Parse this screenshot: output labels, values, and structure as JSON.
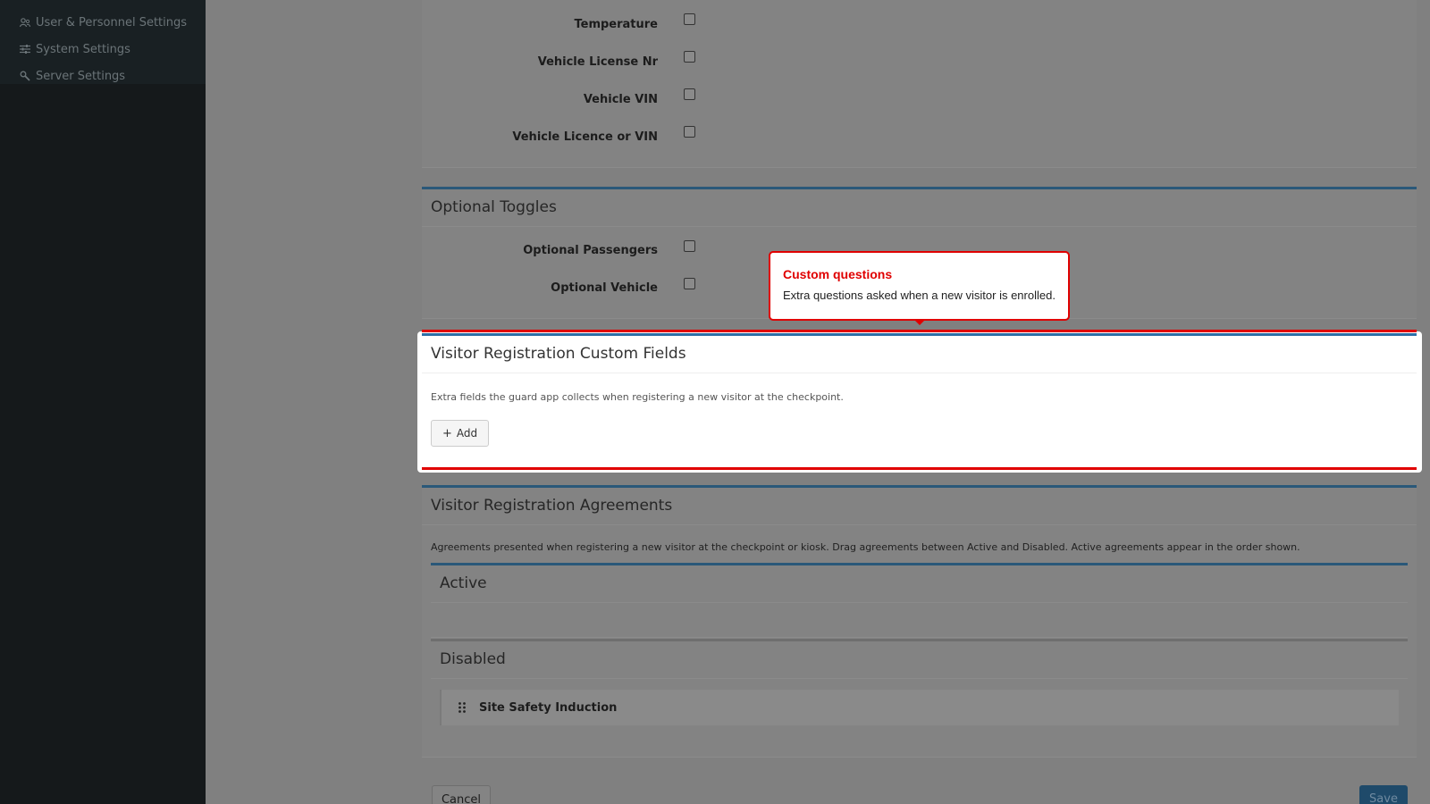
{
  "sidebar": {
    "items": [
      {
        "label": "User & Personnel Settings",
        "icon": "users-icon"
      },
      {
        "label": "System Settings",
        "icon": "sliders-icon"
      },
      {
        "label": "Server Settings",
        "icon": "wrench-icon"
      }
    ]
  },
  "required_fields": {
    "rows": [
      {
        "label": "Temperature",
        "checked": false
      },
      {
        "label": "Vehicle License Nr",
        "checked": false
      },
      {
        "label": "Vehicle VIN",
        "checked": false
      },
      {
        "label": "Vehicle Licence or VIN",
        "checked": false
      }
    ]
  },
  "optional_toggles": {
    "title": "Optional Toggles",
    "rows": [
      {
        "label": "Optional Passengers",
        "checked": false
      },
      {
        "label": "Optional Vehicle",
        "checked": false
      }
    ]
  },
  "custom_fields": {
    "title": "Visitor Registration Custom Fields",
    "description": "Extra fields the guard app collects when registering a new visitor at the checkpoint.",
    "add_label": "Add"
  },
  "tooltip": {
    "title": "Custom questions",
    "body": "Extra questions asked when a new visitor is enrolled."
  },
  "agreements": {
    "title": "Visitor Registration Agreements",
    "description": "Agreements presented when registering a new visitor at the checkpoint or kiosk. Drag agreements between Active and Disabled. Active agreements appear in the order shown.",
    "active_title": "Active",
    "disabled_title": "Disabled",
    "disabled_items": [
      "Site Safety Induction"
    ]
  },
  "footer": {
    "cancel_label": "Cancel",
    "save_label": "Save"
  },
  "colors": {
    "accent": "#2d6fa6",
    "highlight": "#e00000",
    "overlay": "#808080"
  }
}
